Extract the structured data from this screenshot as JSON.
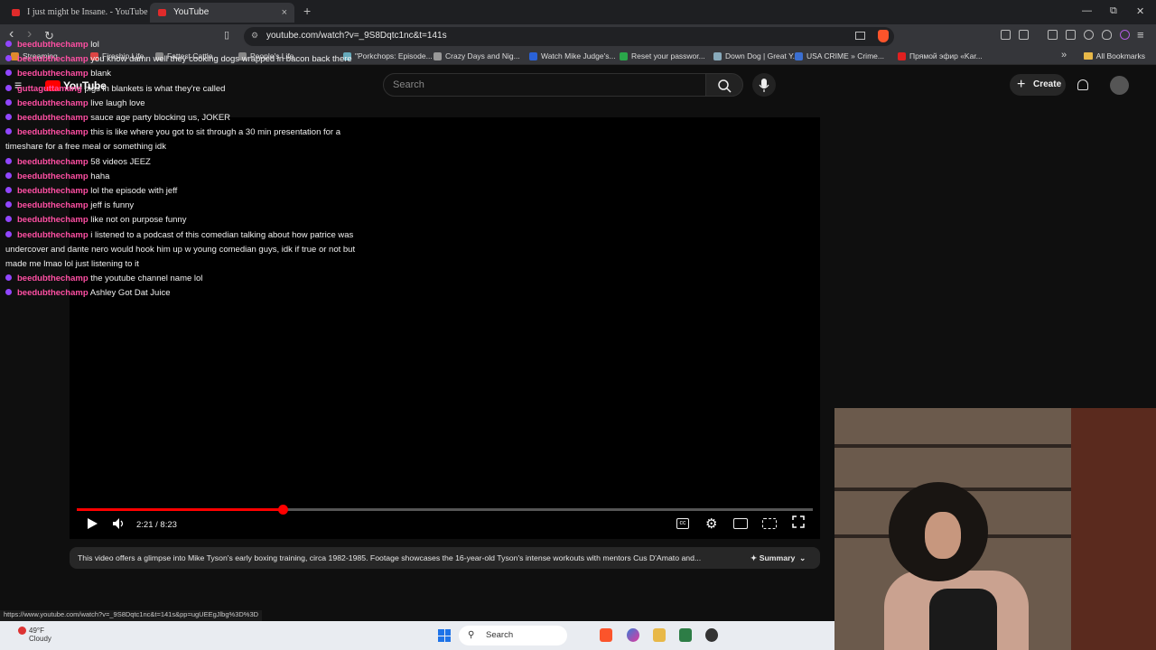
{
  "tabs": [
    {
      "title": "I just might be Insane. - YouTube"
    },
    {
      "title": "YouTube",
      "close": "×"
    }
  ],
  "new_tab": "+",
  "window": {
    "minimize": "—",
    "restore": "⧉",
    "close": "✕"
  },
  "nav": {
    "back": "‹",
    "forward": "›",
    "reload": "↻"
  },
  "address": {
    "url": "youtube.com/watch?v=_9S8Dqtc1nc&t=141s"
  },
  "bookmarks": [
    {
      "label": "Streaming",
      "color": "#e08a2c"
    },
    {
      "label": "Fireship Life",
      "color": "#d44"
    },
    {
      "label": "Fattest Cattle",
      "color": "#888"
    },
    {
      "label": "People's Life",
      "color": "#888"
    },
    {
      "label": "\"Porkchops: Episode...",
      "color": "#6ab"
    },
    {
      "label": "Crazy Days and Nig...",
      "color": "#999"
    },
    {
      "label": "Watch Mike Judge's...",
      "color": "#2a62d8"
    },
    {
      "label": "Reset your passwor...",
      "color": "#2aa64a"
    },
    {
      "label": "Down Dog | Great Y...",
      "color": "#8ab"
    },
    {
      "label": "USA CRIME » Crime...",
      "color": "#3b6fd1"
    },
    {
      "label": "Прямой эфир «Kar...",
      "color": "#e02020"
    }
  ],
  "all_bookmarks": "All Bookmarks",
  "youtube": {
    "logo": "YouTube",
    "search_placeholder": "Search",
    "create_label": "Create"
  },
  "chat": [
    {
      "user": "beedubthechamp",
      "message": "lol"
    },
    {
      "user": "beedubthechamp",
      "message": "you know damn well they cooking dogs wrapped in bacon back there"
    },
    {
      "user": "beedubthechamp",
      "message": "blank"
    },
    {
      "user": "guttaguttamang",
      "message": "pigs in blankets is what they're called"
    },
    {
      "user": "beedubthechamp",
      "message": "live laugh love"
    },
    {
      "user": "beedubthechamp",
      "message": "sauce age party blocking us, JOKER"
    },
    {
      "user": "beedubthechamp",
      "message": "this is like where you got to sit through a 30 min presentation for a timeshare for a free meal or something idk"
    },
    {
      "user": "beedubthechamp",
      "message": "58 videos JEEZ"
    },
    {
      "user": "beedubthechamp",
      "message": "haha"
    },
    {
      "user": "beedubthechamp",
      "message": "lol the episode with jeff"
    },
    {
      "user": "beedubthechamp",
      "message": "jeff is funny"
    },
    {
      "user": "beedubthechamp",
      "message": "like not on purpose funny"
    },
    {
      "user": "beedubthechamp",
      "message": "i listened to a podcast of this comedian talking about how patrice was undercover and dante nero would hook him up w young comedian guys, idk if true or not but made me lmao lol just listening to it"
    },
    {
      "user": "beedubthechamp",
      "message": "the youtube channel name lol"
    },
    {
      "user": "beedubthechamp",
      "message": "Ashley Got Dat Juice"
    }
  ],
  "player": {
    "time": "2:21 / 8:23",
    "progress": 0.28
  },
  "description": {
    "text": "This video offers a glimpse into Mike Tyson's early boxing training, circa 1982-1985. Footage showcases the 16-year-old Tyson's intense workouts with mentors Cus D'Amato and...",
    "summary_label": "Summary"
  },
  "status_url": "https://www.youtube.com/watch?v=_9S8Dqtc1nc&t=141s&pp=ugUEEgJlbg%3D%3D",
  "taskbar": {
    "temp": "49°F",
    "condition": "Cloudy",
    "badge": "1",
    "search_label": "Search"
  }
}
